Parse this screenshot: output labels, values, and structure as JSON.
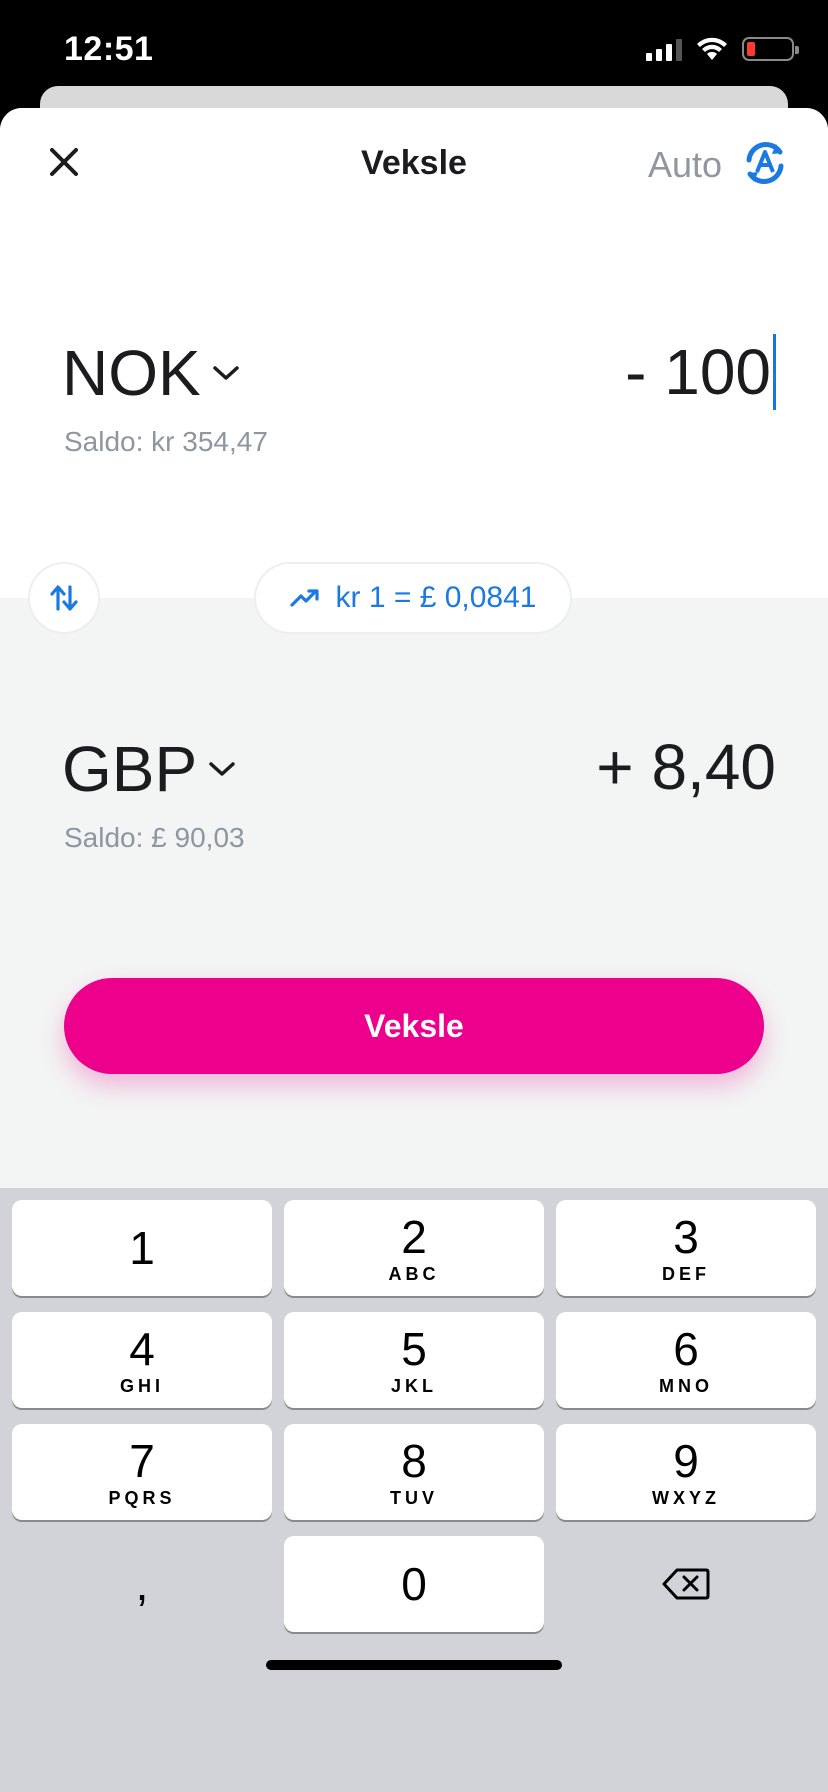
{
  "status": {
    "time": "12:51"
  },
  "header": {
    "title": "Veksle",
    "auto_label": "Auto"
  },
  "from": {
    "currency": "NOK",
    "amount": "- 100",
    "balance": "Saldo: kr 354,47"
  },
  "rate": {
    "text": "kr 1 = £ 0,0841"
  },
  "to": {
    "currency": "GBP",
    "amount": "+ 8,40",
    "balance": "Saldo: £ 90,03"
  },
  "action": {
    "label": "Veksle"
  },
  "keyboard": {
    "keys": [
      {
        "num": "1",
        "letters": ""
      },
      {
        "num": "2",
        "letters": "ABC"
      },
      {
        "num": "3",
        "letters": "DEF"
      },
      {
        "num": "4",
        "letters": "GHI"
      },
      {
        "num": "5",
        "letters": "JKL"
      },
      {
        "num": "6",
        "letters": "MNO"
      },
      {
        "num": "7",
        "letters": "PQRS"
      },
      {
        "num": "8",
        "letters": "TUV"
      },
      {
        "num": "9",
        "letters": "WXYZ"
      },
      {
        "num": ",",
        "letters": ""
      },
      {
        "num": "0",
        "letters": ""
      }
    ]
  },
  "colors": {
    "accent": "#ec008c",
    "link": "#1b7ae0"
  }
}
